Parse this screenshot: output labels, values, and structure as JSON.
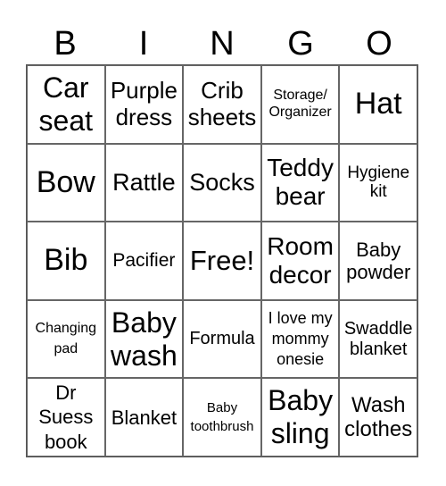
{
  "header": [
    "B",
    "I",
    "N",
    "G",
    "O"
  ],
  "cells": [
    "Car seat",
    "Purple dress",
    "Crib sheets",
    "Storage/ Organizer",
    "Hat",
    "Bow",
    "Rattle",
    "Socks",
    "Teddy bear",
    "Hygiene kit",
    "Bib",
    "Pacifier",
    "Free!",
    "Room decor",
    "Baby powder",
    "Changing pad",
    "Baby wash",
    "Formula",
    "I love my mommy onesie",
    "Swaddle blanket",
    "Dr Suess book",
    "Blanket",
    "Baby toothbrush",
    "Baby sling",
    "Wash clothes"
  ]
}
